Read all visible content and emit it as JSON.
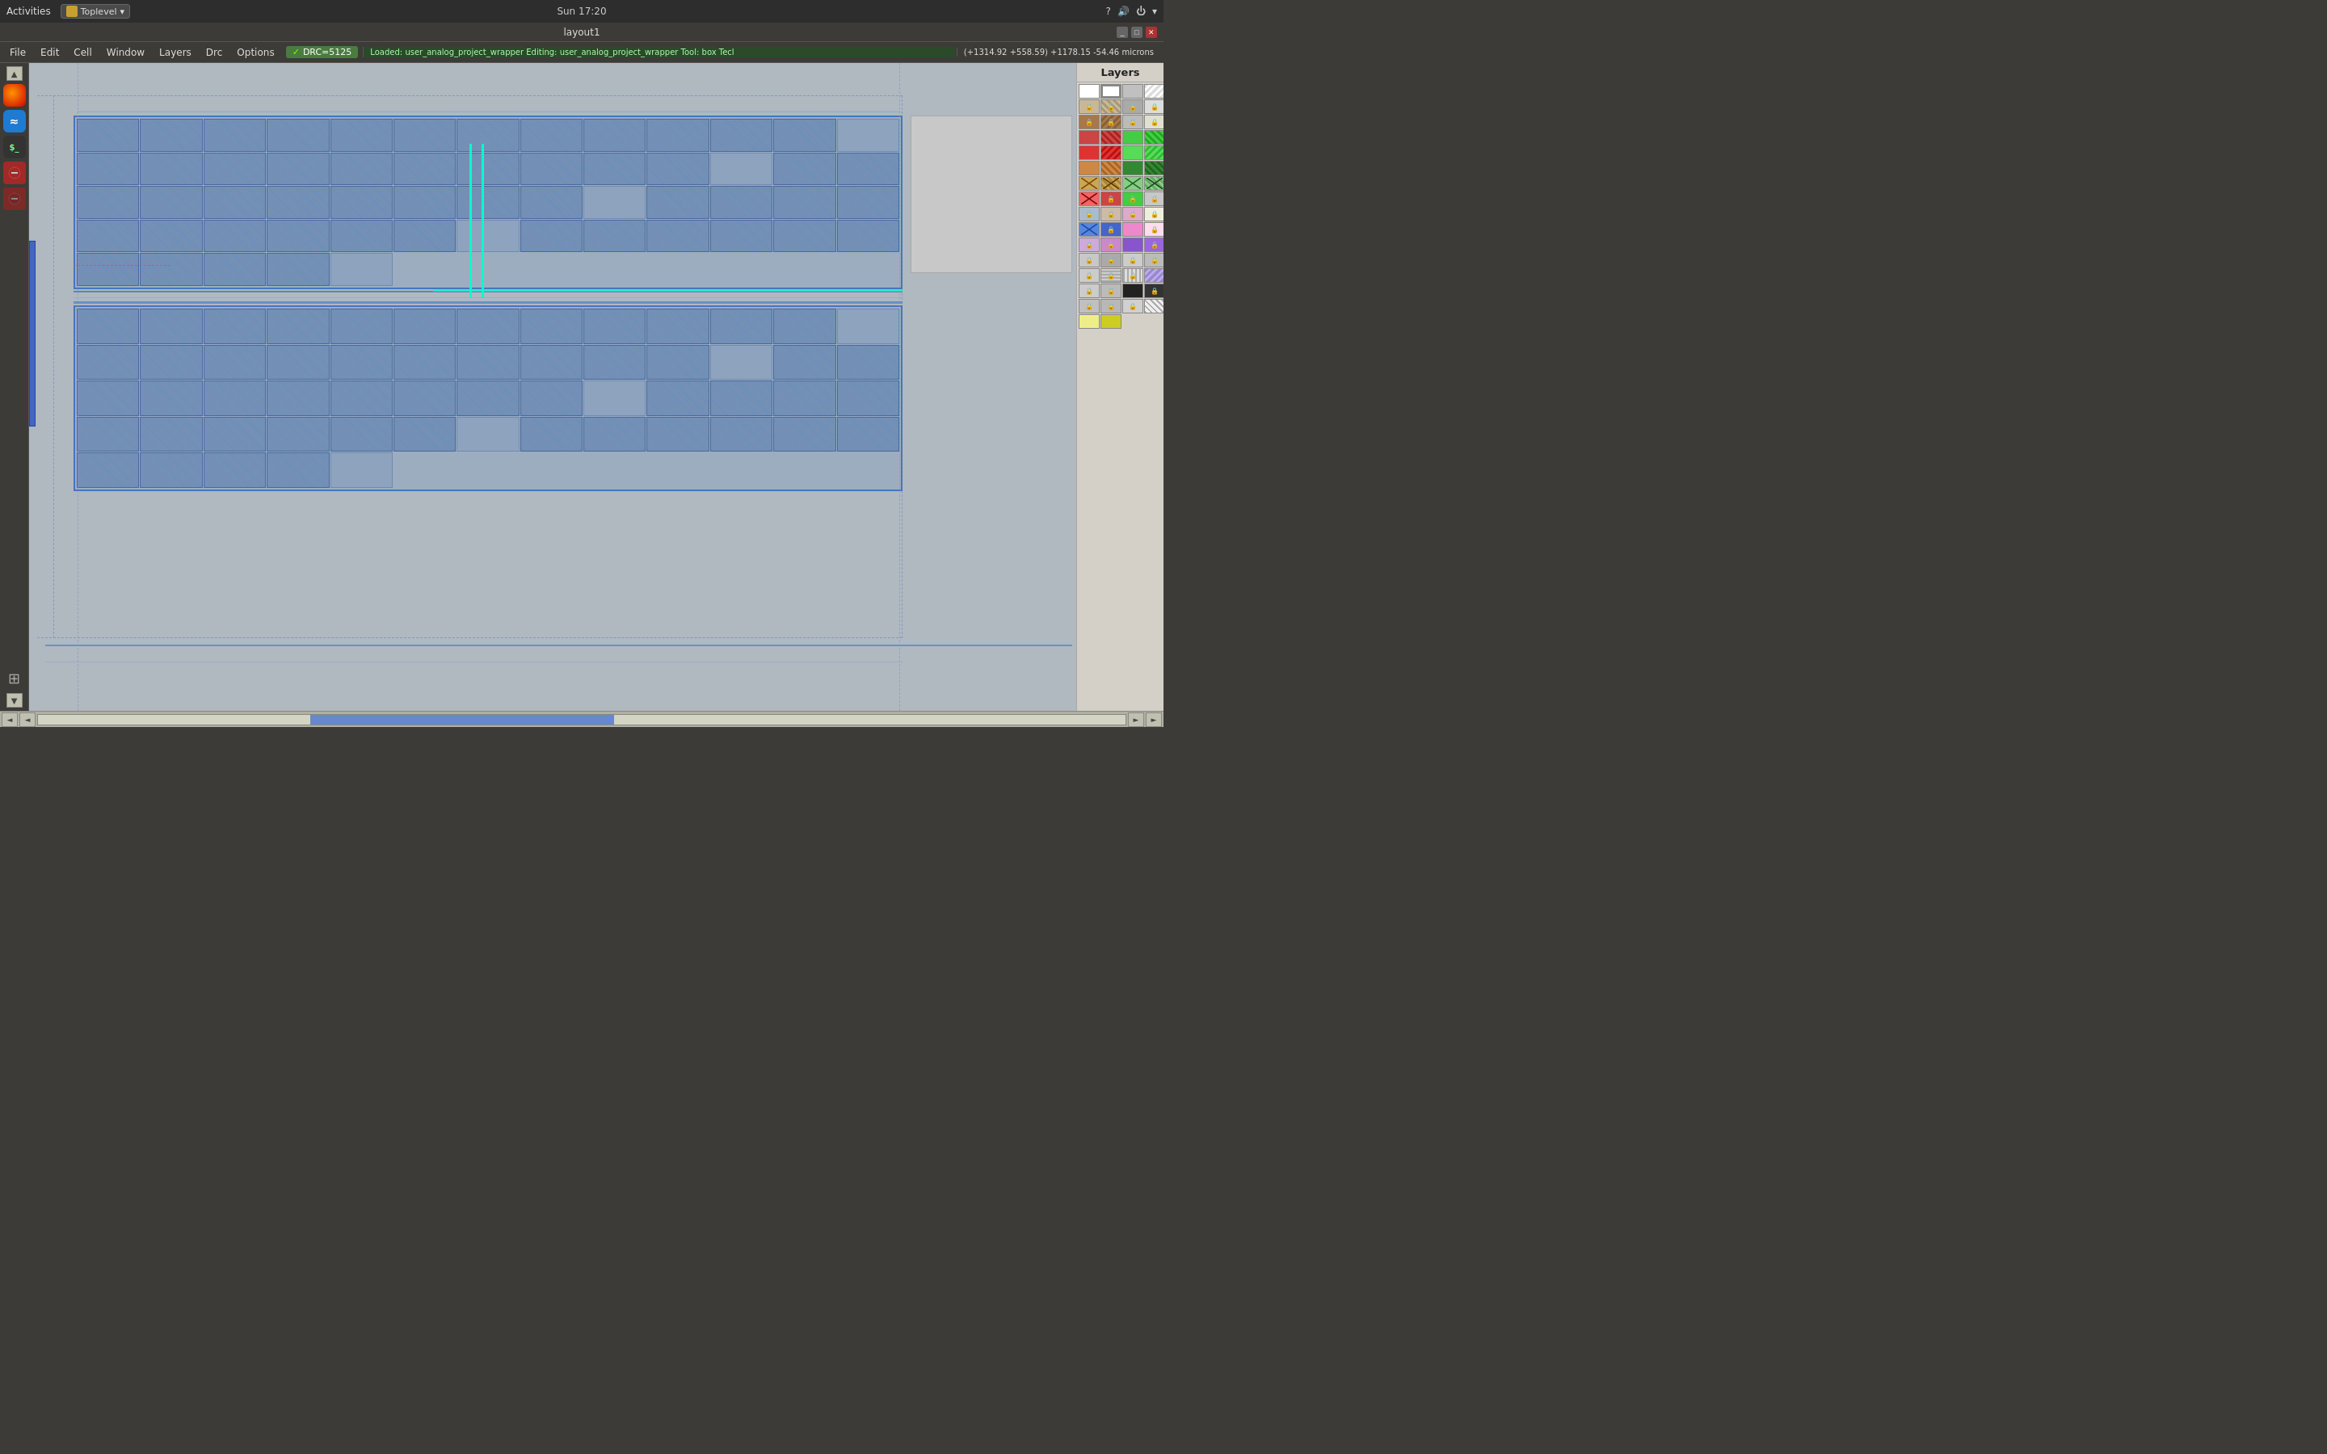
{
  "system_bar": {
    "left": {
      "activities": "Activities",
      "app_name": "Toplevel",
      "dropdown_arrow": "▾"
    },
    "center": {
      "time": "Sun 17:20"
    },
    "right": {
      "help_icon": "?",
      "volume_icon": "🔊",
      "power_icon": "⏻",
      "arrow_icon": "▾"
    }
  },
  "title_bar": {
    "title": "layout1",
    "minimize": "_",
    "restore": "□",
    "close": "✕"
  },
  "menu_bar": {
    "items": [
      "File",
      "Edit",
      "Cell",
      "Window",
      "Layers",
      "Drc",
      "Options"
    ],
    "drc_badge": "DRC=5125",
    "status_text": "Loaded: user_analog_project_wrapper  Editing: user_analog_project_wrapper  Tool: box   Tecl",
    "coords": "(+1314.92 +558.59) +1178.15 -54.46 microns"
  },
  "layers_panel": {
    "header": "Layers",
    "rows": [
      [
        "white",
        "white-box",
        "gray",
        "light"
      ],
      [
        "tan-lock",
        "tan-hatch-lock",
        "gray-lock",
        "light-lock"
      ],
      [
        "brown-lock",
        "brown-hatch-lock",
        "gray2-lock",
        "light2-lock"
      ],
      [
        "red",
        "red-hatch",
        "green",
        "green-hatch"
      ],
      [
        "red2",
        "red2-hatch",
        "green2",
        "green2-hatch"
      ],
      [
        "orange",
        "orange-hatch",
        "dark-green",
        "dark-green-hatch"
      ],
      [
        "x-brown",
        "x-brown-hatch",
        "x-green",
        "x-green-hatch"
      ],
      [
        "x-red",
        "x-red-lock",
        "x-green2-lock",
        "x-lock"
      ],
      [
        "x2-lock",
        "x2-lock2",
        "x3-lock",
        "light3-lock"
      ],
      [
        "blue",
        "blue-lock",
        "pink",
        "light-pink"
      ],
      [
        "x4",
        "x4-lock",
        "purple",
        "purple-lock"
      ],
      [
        "gray3",
        "gray3-lock",
        "gray4",
        "gray4-lock"
      ],
      [
        "x5",
        "x5-lock",
        "gray5",
        "diag"
      ],
      [
        "x6-lock",
        "x6-lock2",
        "black",
        "black-lock"
      ],
      [
        "gray6-lock",
        "gray7-lock",
        "gray8-lock",
        "gray9-lock"
      ],
      [
        "yellow-light",
        "yellow"
      ]
    ]
  },
  "canvas": {
    "background_color": "#9aabb8",
    "circuit_color": "#c0ccdc"
  },
  "scrollbar": {
    "left_arrow": "◄",
    "right_arrow": "►",
    "up_arrow": "▲",
    "down_arrow": "▼"
  }
}
